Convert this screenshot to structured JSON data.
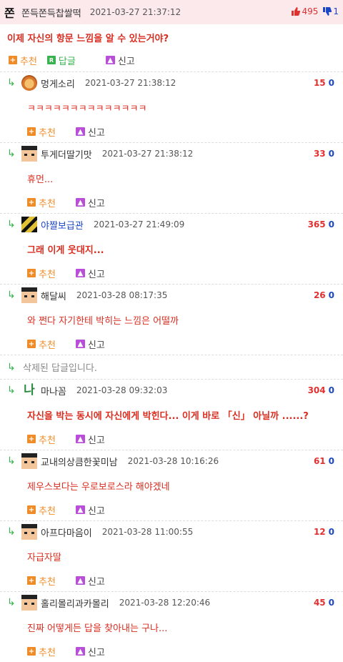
{
  "post": {
    "badge": "쫀",
    "nick": "쫀득쫀득찹쌀떡",
    "time": "2021-03-27 21:37:12",
    "up_icon": "thumbs-up-icon",
    "up_count": "495",
    "down_icon": "thumbs-down-icon",
    "down_count": "1",
    "title": "이제 자신의 항문 느낌을 알 수 있는거야?",
    "actions": {
      "recommend": "추천",
      "reply": "답글",
      "report": "신고",
      "reply_icon_letter": "R"
    }
  },
  "labels": {
    "recommend": "추천",
    "report": "신고",
    "arrow": "↳"
  },
  "comments": [
    {
      "nick": "멍게소리",
      "time": "2021-03-27 21:38:12",
      "up": "15",
      "down": "0",
      "body": "ㅋㅋㅋㅋㅋㅋㅋㅋㅋㅋㅋㅋㅋㅋ"
    },
    {
      "nick": "투게더딸기맛",
      "time": "2021-03-27 21:38:12",
      "up": "33",
      "down": "0",
      "body": "휴먼..."
    },
    {
      "nick": "야짤보급관",
      "time": "2021-03-27 21:49:09",
      "up": "365",
      "down": "0",
      "body": "그래 이게 웃대지..."
    },
    {
      "nick": "해달씨",
      "time": "2021-03-28 08:17:35",
      "up": "26",
      "down": "0",
      "body": "와 쩐다 자기한테 박히는 느낌은 어떨까"
    },
    {
      "deleted": "삭제된 답글입니다."
    },
    {
      "nick": "마나꼼",
      "avatar_text": "나",
      "time": "2021-03-28 09:32:03",
      "up": "304",
      "down": "0",
      "body": "자신을 박는 동시에 자신에게 박힌다... 이게 바로 「신」 아닐까 ......?"
    },
    {
      "nick": "교내의상큼한꽃미남",
      "time": "2021-03-28 10:16:26",
      "up": "61",
      "down": "0",
      "body": "제우스보다는 우로보로스라 해야겠네"
    },
    {
      "nick": "아프다마음이",
      "time": "2021-03-28 11:00:55",
      "up": "12",
      "down": "0",
      "body": "자급자딸"
    },
    {
      "nick": "홀리몰리과카몰리",
      "time": "2021-03-28 12:20:46",
      "up": "45",
      "down": "0",
      "body": "진짜 어떻게든 답을 찾아내는 구나..."
    }
  ],
  "colors": {
    "accent_red": "#d92d20",
    "up": "#e03131",
    "down": "#1c46c8",
    "reply_arrow": "#37b24d",
    "recommend": "#f08c28"
  }
}
